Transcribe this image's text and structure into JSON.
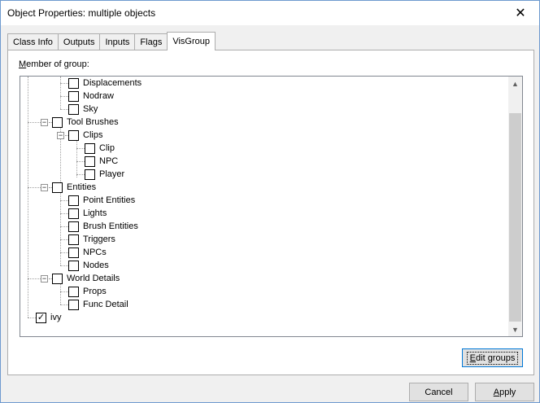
{
  "window": {
    "title": "Object Properties: multiple objects",
    "close_glyph": "✕"
  },
  "tabs": [
    {
      "label": "Class Info"
    },
    {
      "label": "Outputs"
    },
    {
      "label": "Inputs"
    },
    {
      "label": "Flags"
    },
    {
      "label": "VisGroup"
    }
  ],
  "active_tab": "VisGroup",
  "visgroup": {
    "member_label_first": "M",
    "member_label_rest": "ember of group:",
    "tree": [
      {
        "label": "Displacements",
        "checked": false
      },
      {
        "label": "Nodraw",
        "checked": false
      },
      {
        "label": "Sky",
        "checked": false
      },
      {
        "label": "Tool Brushes",
        "checked": false,
        "expanded": true
      },
      {
        "label": "Clips",
        "checked": false,
        "expanded": true
      },
      {
        "label": "Clip",
        "checked": false
      },
      {
        "label": "NPC",
        "checked": false
      },
      {
        "label": "Player",
        "checked": false
      },
      {
        "label": "Entities",
        "checked": false,
        "expanded": true
      },
      {
        "label": "Point Entities",
        "checked": false
      },
      {
        "label": "Lights",
        "checked": false
      },
      {
        "label": "Brush Entities",
        "checked": false
      },
      {
        "label": "Triggers",
        "checked": false
      },
      {
        "label": "NPCs",
        "checked": false
      },
      {
        "label": "Nodes",
        "checked": false
      },
      {
        "label": "World Details",
        "checked": false,
        "expanded": true
      },
      {
        "label": "Props",
        "checked": false
      },
      {
        "label": "Func Detail",
        "checked": false
      },
      {
        "label": "ivy",
        "checked": true
      }
    ],
    "edit_groups_first": "E",
    "edit_groups_rest": "dit groups"
  },
  "buttons": {
    "cancel": "Cancel",
    "apply_first": "A",
    "apply_rest": "pply"
  },
  "glyphs": {
    "check": "✓",
    "minus": "−",
    "scroll_up": "▲",
    "scroll_down": "▼"
  }
}
